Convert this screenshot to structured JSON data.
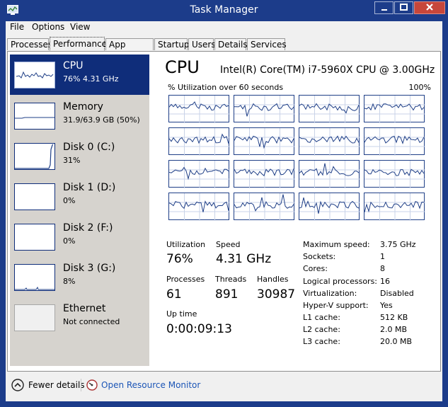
{
  "window": {
    "title": "Task Manager"
  },
  "menu": {
    "file": "File",
    "options": "Options",
    "view": "View"
  },
  "tabs": [
    {
      "label": "Processes"
    },
    {
      "label": "Performance"
    },
    {
      "label": "App history"
    },
    {
      "label": "Startup"
    },
    {
      "label": "Users"
    },
    {
      "label": "Details"
    },
    {
      "label": "Services"
    }
  ],
  "sidebar": [
    {
      "name": "CPU",
      "sub": "76% 4.31 GHz"
    },
    {
      "name": "Memory",
      "sub": "31.9/63.9 GB (50%)"
    },
    {
      "name": "Disk 0 (C:)",
      "sub": "31%"
    },
    {
      "name": "Disk 1 (D:)",
      "sub": "0%"
    },
    {
      "name": "Disk 2 (F:)",
      "sub": "0%"
    },
    {
      "name": "Disk 3 (G:)",
      "sub": "8%"
    },
    {
      "name": "Ethernet",
      "sub": "Not connected"
    }
  ],
  "cpu": {
    "title": "CPU",
    "model": "Intel(R) Core(TM) i7-5960X CPU @ 3.00GHz",
    "graph_label": "% Utilization over 60 seconds",
    "graph_max": "100%"
  },
  "stats": {
    "utilization_label": "Utilization",
    "utilization": "76%",
    "speed_label": "Speed",
    "speed": "4.31 GHz",
    "processes_label": "Processes",
    "processes": "61",
    "threads_label": "Threads",
    "threads": "891",
    "handles_label": "Handles",
    "handles": "30987",
    "uptime_label": "Up time",
    "uptime": "0:00:09:13"
  },
  "specs": [
    {
      "label": "Maximum speed:",
      "value": "3.75 GHz"
    },
    {
      "label": "Sockets:",
      "value": "1"
    },
    {
      "label": "Cores:",
      "value": "8"
    },
    {
      "label": "Logical processors:",
      "value": "16"
    },
    {
      "label": "Virtualization:",
      "value": "Disabled"
    },
    {
      "label": "Hyper-V support:",
      "value": "Yes"
    },
    {
      "label": "L1 cache:",
      "value": "512 KB"
    },
    {
      "label": "L2 cache:",
      "value": "2.0 MB"
    },
    {
      "label": "L3 cache:",
      "value": "20.0 MB"
    }
  ],
  "footer": {
    "fewer_details": "Fewer details",
    "open_monitor": "Open Resource Monitor"
  },
  "colors": {
    "title_bar": "#1c3c8a",
    "selected": "#0f2d7a",
    "graph_border": "#1f3f87",
    "close": "#c7463a",
    "link": "#1b55b6"
  }
}
